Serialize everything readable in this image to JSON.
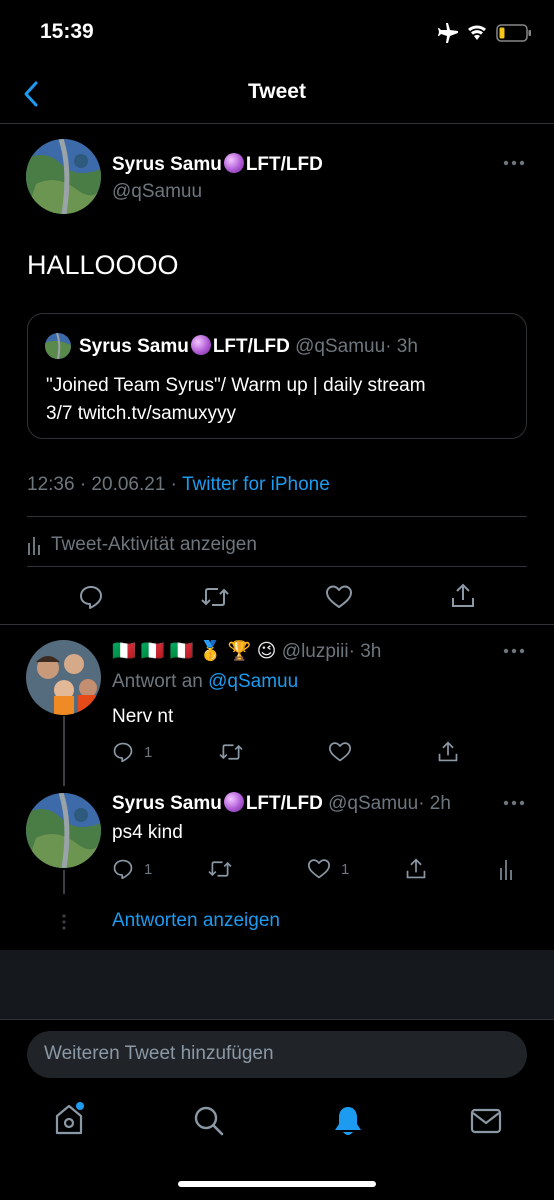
{
  "status_bar": {
    "time": "15:39"
  },
  "nav": {
    "title": "Tweet"
  },
  "main_tweet": {
    "name": "Syrus Samu",
    "name_suffix": "LFT/LFD",
    "handle": "@qSamuu",
    "text": "HALLOOOO",
    "quote": {
      "name": "Syrus Samu",
      "name_suffix": "LFT/LFD",
      "handle": "@qSamuu",
      "time": "· 3h",
      "text_line1": "\"Joined Team Syrus\"/ Warm up | daily stream",
      "text_line2": "3/7 twitch.tv/samuxyyy"
    },
    "timestamp": "12:36 · 20.06.21 ·",
    "source": "Twitter for iPhone",
    "activity_label": "Tweet-Aktivität anzeigen"
  },
  "reply1": {
    "emojis": "🇮🇹 🇮🇹 🇮🇹 🥇 🏆 😉",
    "handle": "@luzpiii",
    "time": "· 3h",
    "reply_to_label": "Antwort an",
    "reply_to_handle": "@qSamuu",
    "text": "Nerv nt",
    "reply_count": "1"
  },
  "reply2": {
    "name": "Syrus Samu",
    "name_suffix": "LFT/LFD",
    "handle": "@qSamuu",
    "time": "· 2h",
    "text": "ps4 kind",
    "reply_count": "1",
    "like_count": "1"
  },
  "show_replies": "Antworten anzeigen",
  "compose": {
    "placeholder": "Weiteren Tweet hinzufügen"
  },
  "tab_bar": {
    "items": [
      "home-icon",
      "search-icon",
      "notifications-icon",
      "messages-icon"
    ],
    "active": "notifications-icon"
  },
  "colors": {
    "accent": "#1d9bf0",
    "background": "#000000",
    "muted": "#6e767d"
  }
}
